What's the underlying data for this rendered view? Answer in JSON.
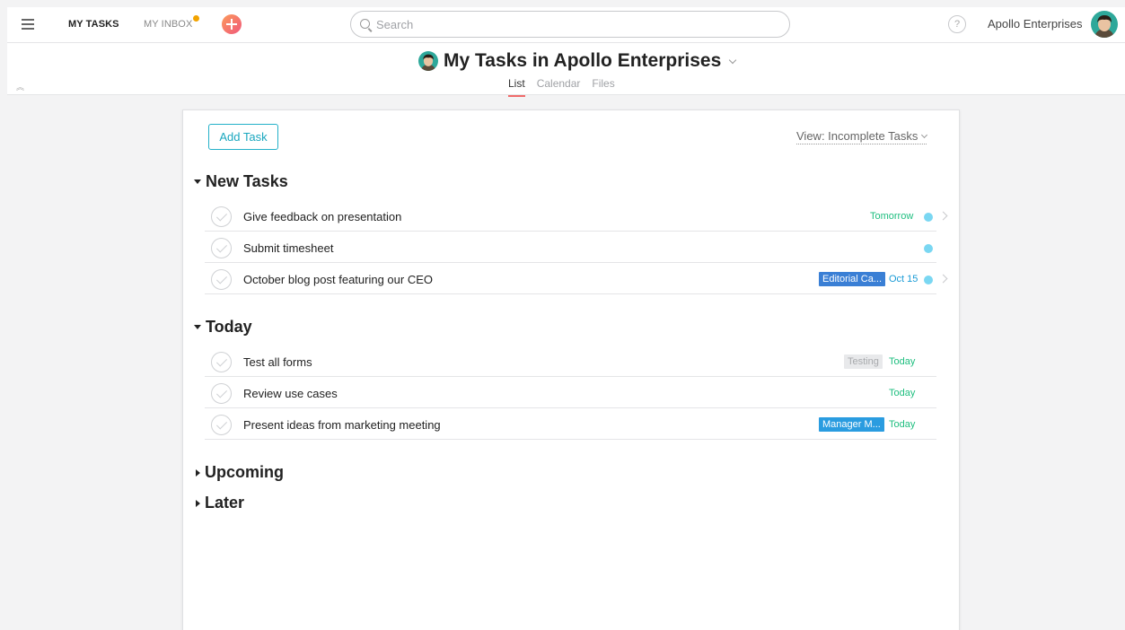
{
  "topbar": {
    "my_tasks": "MY TASKS",
    "my_inbox": "MY INBOX",
    "search_placeholder": "Search",
    "help_label": "?",
    "org_name": "Apollo Enterprises"
  },
  "header": {
    "title": "My Tasks in Apollo Enterprises",
    "tabs": [
      {
        "label": "List",
        "active": true
      },
      {
        "label": "Calendar",
        "active": false
      },
      {
        "label": "Files",
        "active": false
      }
    ]
  },
  "toolbar": {
    "add_task": "Add Task",
    "view_filter": "View: Incomplete Tasks"
  },
  "sections": {
    "new_tasks": {
      "title": "New Tasks",
      "tasks": [
        {
          "name": "Give feedback on presentation",
          "due": "Tomorrow"
        },
        {
          "name": "Submit timesheet"
        },
        {
          "name": "October blog post featuring our CEO",
          "tag": "Editorial Ca...",
          "due": "Oct 15"
        }
      ]
    },
    "today": {
      "title": "Today",
      "tasks": [
        {
          "name": "Test all forms",
          "tag": "Testing",
          "due": "Today"
        },
        {
          "name": "Review use cases",
          "due": "Today"
        },
        {
          "name": "Present ideas from marketing meeting",
          "tag": "Manager M...",
          "due": "Today"
        }
      ]
    },
    "upcoming": {
      "title": "Upcoming"
    },
    "later": {
      "title": "Later"
    }
  },
  "colors": {
    "accent_teal": "#1aa7bf",
    "due_green": "#1ebe7f",
    "tag_editorial": "#3a7fd5",
    "tag_manager": "#2a9ce0",
    "tag_testing_bg": "#e8e9eb",
    "inbox_dot": "#f2a300",
    "active_tab_underline": "#f06a6a"
  },
  "icons": {
    "menu": "hamburger-icon",
    "add": "plus-circle-icon",
    "search": "search-icon",
    "help": "help-icon",
    "collapse": "double-chevron-up-icon",
    "check": "check-circle-icon",
    "row_open": "chevron-right-icon"
  }
}
